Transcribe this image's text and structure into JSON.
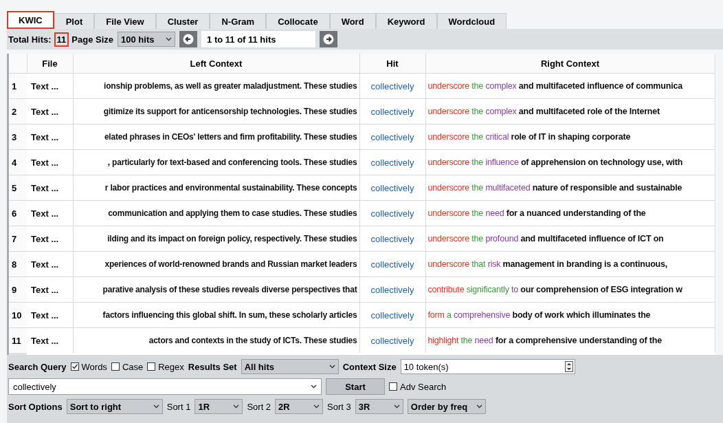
{
  "tabs": [
    {
      "label": "KWIC",
      "selected": true,
      "annotated": true
    },
    {
      "label": "Plot",
      "selected": false,
      "annotated": false
    },
    {
      "label": "File View",
      "selected": false,
      "annotated": false
    },
    {
      "label": "Cluster",
      "selected": false,
      "annotated": false
    },
    {
      "label": "N-Gram",
      "selected": false,
      "annotated": false
    },
    {
      "label": "Collocate",
      "selected": false,
      "annotated": false
    },
    {
      "label": "Word",
      "selected": false,
      "annotated": false
    },
    {
      "label": "Keyword",
      "selected": false,
      "annotated": false
    },
    {
      "label": "Wordcloud",
      "selected": false,
      "annotated": false
    }
  ],
  "toolbar": {
    "total_hits_label": "Total Hits:",
    "total_hits": "11",
    "total_hits_annotated": true,
    "page_size_label": "Page Size",
    "page_size": "100 hits",
    "range": "1 to 11 of 11 hits"
  },
  "table": {
    "columns": [
      "File",
      "Left Context",
      "Hit",
      "Right Context"
    ],
    "rows": [
      {
        "number": "1",
        "file": "Text ...",
        "left": "ionship problems, as well as greater maladjustment. These studies",
        "hit": "collectively",
        "right_words": [
          {
            "text": "underscore",
            "color": "#e8321e"
          },
          {
            "text": "the",
            "color": "#3a9a3a"
          },
          {
            "text": "complex",
            "color": "#8a3ca8"
          }
        ],
        "right_rest": "and multifaceted influence of communica"
      },
      {
        "number": "2",
        "file": "Text ...",
        "left": "gitimize its support for anticensorship technologies. These studies",
        "hit": "collectively",
        "right_words": [
          {
            "text": "underscore",
            "color": "#e8321e"
          },
          {
            "text": "the",
            "color": "#3a9a3a"
          },
          {
            "text": "complex",
            "color": "#8a3ca8"
          }
        ],
        "right_rest": "and multifaceted role of the Internet"
      },
      {
        "number": "3",
        "file": "Text ...",
        "left": "elated phrases in CEOs' letters and firm profitability. These studies",
        "hit": "collectively",
        "right_words": [
          {
            "text": "underscore",
            "color": "#e8321e"
          },
          {
            "text": "the",
            "color": "#3a9a3a"
          },
          {
            "text": "critical",
            "color": "#8a3ca8"
          }
        ],
        "right_rest": "role of IT in shaping corporate"
      },
      {
        "number": "4",
        "file": "Text ...",
        "left": ", particularly for text-based and conferencing tools. These studies",
        "hit": "collectively",
        "right_words": [
          {
            "text": "underscore",
            "color": "#e8321e"
          },
          {
            "text": "the",
            "color": "#3a9a3a"
          },
          {
            "text": "influence",
            "color": "#8a3ca8"
          }
        ],
        "right_rest": "of apprehension on technology use, with"
      },
      {
        "number": "5",
        "file": "Text ...",
        "left": "r labor practices and environmental sustainability. These concepts",
        "hit": "collectively",
        "right_words": [
          {
            "text": "underscore",
            "color": "#e8321e"
          },
          {
            "text": "the",
            "color": "#3a9a3a"
          },
          {
            "text": "multifaceted",
            "color": "#8a3ca8"
          }
        ],
        "right_rest": "nature of responsible and sustainable"
      },
      {
        "number": "6",
        "file": "Text ...",
        "left": "communication and applying them to case studies. These studies",
        "hit": "collectively",
        "right_words": [
          {
            "text": "underscore",
            "color": "#e8321e"
          },
          {
            "text": "the",
            "color": "#3a9a3a"
          },
          {
            "text": "need",
            "color": "#8a3ca8"
          }
        ],
        "right_rest": "for a nuanced understanding of the"
      },
      {
        "number": "7",
        "file": "Text ...",
        "left": "ilding and its impact on foreign policy, respectively. These studies",
        "hit": "collectively",
        "right_words": [
          {
            "text": "underscore",
            "color": "#e8321e"
          },
          {
            "text": "the",
            "color": "#3a9a3a"
          },
          {
            "text": "profound",
            "color": "#8a3ca8"
          }
        ],
        "right_rest": "and multifaceted influence of ICT on"
      },
      {
        "number": "8",
        "file": "Text ...",
        "left": "xperiences of world-renowned brands and Russian market leaders",
        "hit": "collectively",
        "right_words": [
          {
            "text": "underscore",
            "color": "#e8321e"
          },
          {
            "text": "that",
            "color": "#3a9a3a"
          },
          {
            "text": "risk",
            "color": "#8a3ca8"
          }
        ],
        "right_rest": "management in branding is a continuous,"
      },
      {
        "number": "9",
        "file": "Text ...",
        "left": "parative analysis of these studies reveals diverse perspectives that",
        "hit": "collectively",
        "right_words": [
          {
            "text": "contribute",
            "color": "#e8321e"
          },
          {
            "text": "significantly",
            "color": "#3a9a3a"
          },
          {
            "text": "to",
            "color": "#8a3ca8"
          }
        ],
        "right_rest": "our comprehension of ESG integration w"
      },
      {
        "number": "10",
        "file": "Text ...",
        "left": "factors influencing this global shift. In sum, these scholarly articles",
        "hit": "collectively",
        "right_words": [
          {
            "text": "form",
            "color": "#e8321e"
          },
          {
            "text": "a",
            "color": "#3a9a3a"
          },
          {
            "text": "comprehensive",
            "color": "#8a3ca8"
          }
        ],
        "right_rest": "body of work which illuminates the"
      },
      {
        "number": "11",
        "file": "Text ...",
        "left": "actors and contexts in the study of ICTs. These studies",
        "hit": "collectively",
        "right_words": [
          {
            "text": "highlight",
            "color": "#e8321e"
          },
          {
            "text": "the",
            "color": "#3a9a3a"
          },
          {
            "text": "need",
            "color": "#8a3ca8"
          }
        ],
        "right_rest": "for a comprehensive understanding of the"
      }
    ]
  },
  "search": {
    "label": "Search Query",
    "options": [
      {
        "label": "Words",
        "checked": true
      },
      {
        "label": "Case",
        "checked": false
      },
      {
        "label": "Regex",
        "checked": false
      }
    ],
    "results_set_label": "Results Set",
    "results_set": "All hits",
    "context_size_label": "Context Size",
    "context_size": "10 token(s)",
    "query": "collectively",
    "start": "Start",
    "adv_search": {
      "label": "Adv Search",
      "checked": false
    }
  },
  "sort": {
    "label": "Sort Options",
    "mode": "Sort to right",
    "levels": [
      {
        "label": "Sort 1",
        "value": "1R"
      },
      {
        "label": "Sort 2",
        "value": "2R"
      },
      {
        "label": "Sort 3",
        "value": "3R"
      }
    ],
    "order": "Order by freq"
  }
}
